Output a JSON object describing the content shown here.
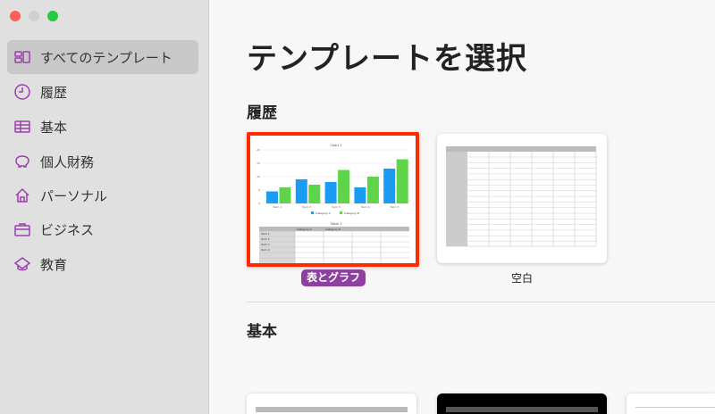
{
  "sidebar": {
    "items": [
      {
        "label": "すべてのテンプレート",
        "icon": "grid-icon"
      },
      {
        "label": "履歴",
        "icon": "clock-icon"
      },
      {
        "label": "基本",
        "icon": "table-icon"
      },
      {
        "label": "個人財務",
        "icon": "piggy-bank-icon"
      },
      {
        "label": "パーソナル",
        "icon": "house-icon"
      },
      {
        "label": "ビジネス",
        "icon": "briefcase-icon"
      },
      {
        "label": "教育",
        "icon": "graduation-cap-icon"
      }
    ]
  },
  "main": {
    "title": "テンプレートを選択",
    "recent_heading": "履歴",
    "basic_heading": "基本",
    "templates": [
      {
        "label": "表とグラフ"
      },
      {
        "label": "空白"
      }
    ]
  },
  "chart_data": {
    "type": "bar",
    "title": "Chart 1",
    "categories": [
      "Item 1",
      "Item 2",
      "Item 3",
      "Item 4",
      "Item 5"
    ],
    "series": [
      {
        "name": "Category A",
        "values": [
          4.5,
          9,
          8,
          6,
          13
        ],
        "color": "#1a9cf5"
      },
      {
        "name": "Category B",
        "values": [
          6,
          7,
          12.5,
          10,
          16.5
        ],
        "color": "#5fd44a"
      }
    ],
    "ylim": [
      0,
      20
    ],
    "yticks": [
      "0",
      "5",
      "10",
      "15",
      "20"
    ],
    "table_title": "Table 1"
  },
  "colors": {
    "accent": "#8e3fa0",
    "selection": "#ff2a00"
  }
}
